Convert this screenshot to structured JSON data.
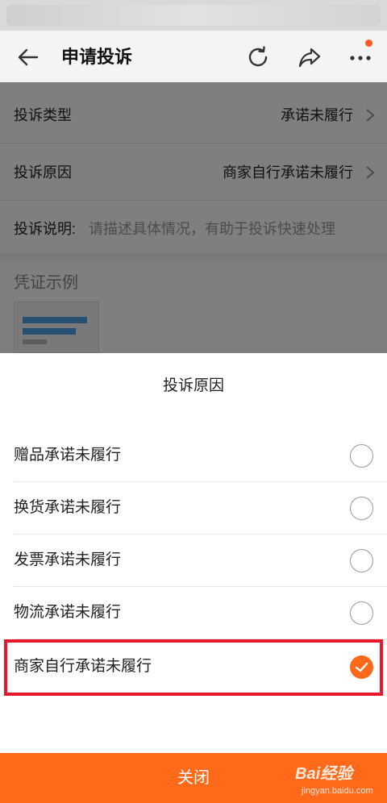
{
  "header": {
    "title": "申请投诉"
  },
  "form": {
    "rows": [
      {
        "label": "投诉类型",
        "value": "承诺未履行"
      },
      {
        "label": "投诉原因",
        "value": "商家自行承诺未履行"
      }
    ],
    "description": {
      "label": "投诉说明:",
      "placeholder": "请描述具体情况，有助于投诉快速处理"
    },
    "evidence": {
      "title": "凭证示例"
    }
  },
  "sheet": {
    "title": "投诉原因",
    "options": [
      {
        "label": "赠品承诺未履行",
        "selected": false
      },
      {
        "label": "换货承诺未履行",
        "selected": false
      },
      {
        "label": "发票承诺未履行",
        "selected": false
      },
      {
        "label": "物流承诺未履行",
        "selected": false
      },
      {
        "label": "商家自行承诺未履行",
        "selected": true
      }
    ],
    "close_label": "关闭"
  },
  "colors": {
    "accent": "#ff6a1a",
    "highlight_border": "#e8172b"
  },
  "watermark": {
    "brand": "Bai经验",
    "url": "jingyan.baidu.com"
  },
  "icons": {
    "back": "arrow-left-icon",
    "refresh": "refresh-icon",
    "share": "share-icon",
    "more": "more-dots-icon",
    "chevron": "chevron-right-icon",
    "check": "check-icon"
  }
}
